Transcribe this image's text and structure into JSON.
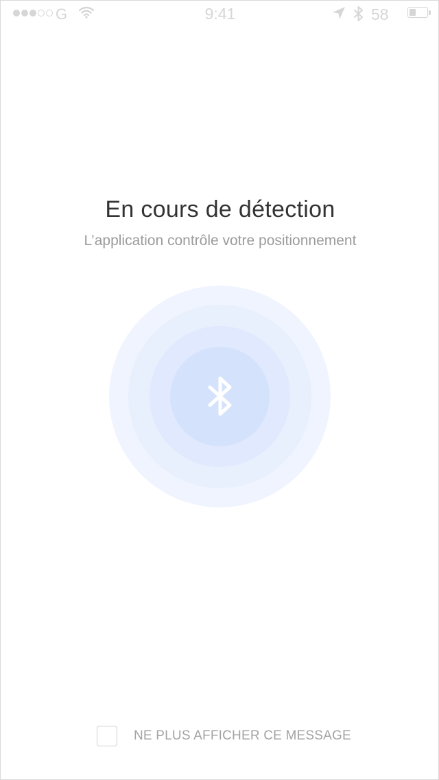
{
  "status_bar": {
    "carrier": "G",
    "time": "9:41",
    "battery_percent": "58",
    "battery_level": 0.4,
    "signal_bars_filled": 3,
    "signal_bars_total": 5,
    "icons": [
      "signal-dots",
      "wifi-icon",
      "location-arrow-icon",
      "bluetooth-icon",
      "battery-icon"
    ]
  },
  "main": {
    "title": "En cours de détection",
    "subtitle": "L’application contrôle votre positionnement",
    "center_icon": "bluetooth-icon"
  },
  "footer": {
    "checkbox_checked": false,
    "dont_show_label": "NE PLUS AFFICHER CE MESSAGE"
  },
  "colors": {
    "status_gray": "#d6d6d6",
    "title": "#333333",
    "subtitle": "#9b9b9b",
    "ring_outer": "#f0f4fe",
    "ring_inner": "#d5e2fc"
  }
}
